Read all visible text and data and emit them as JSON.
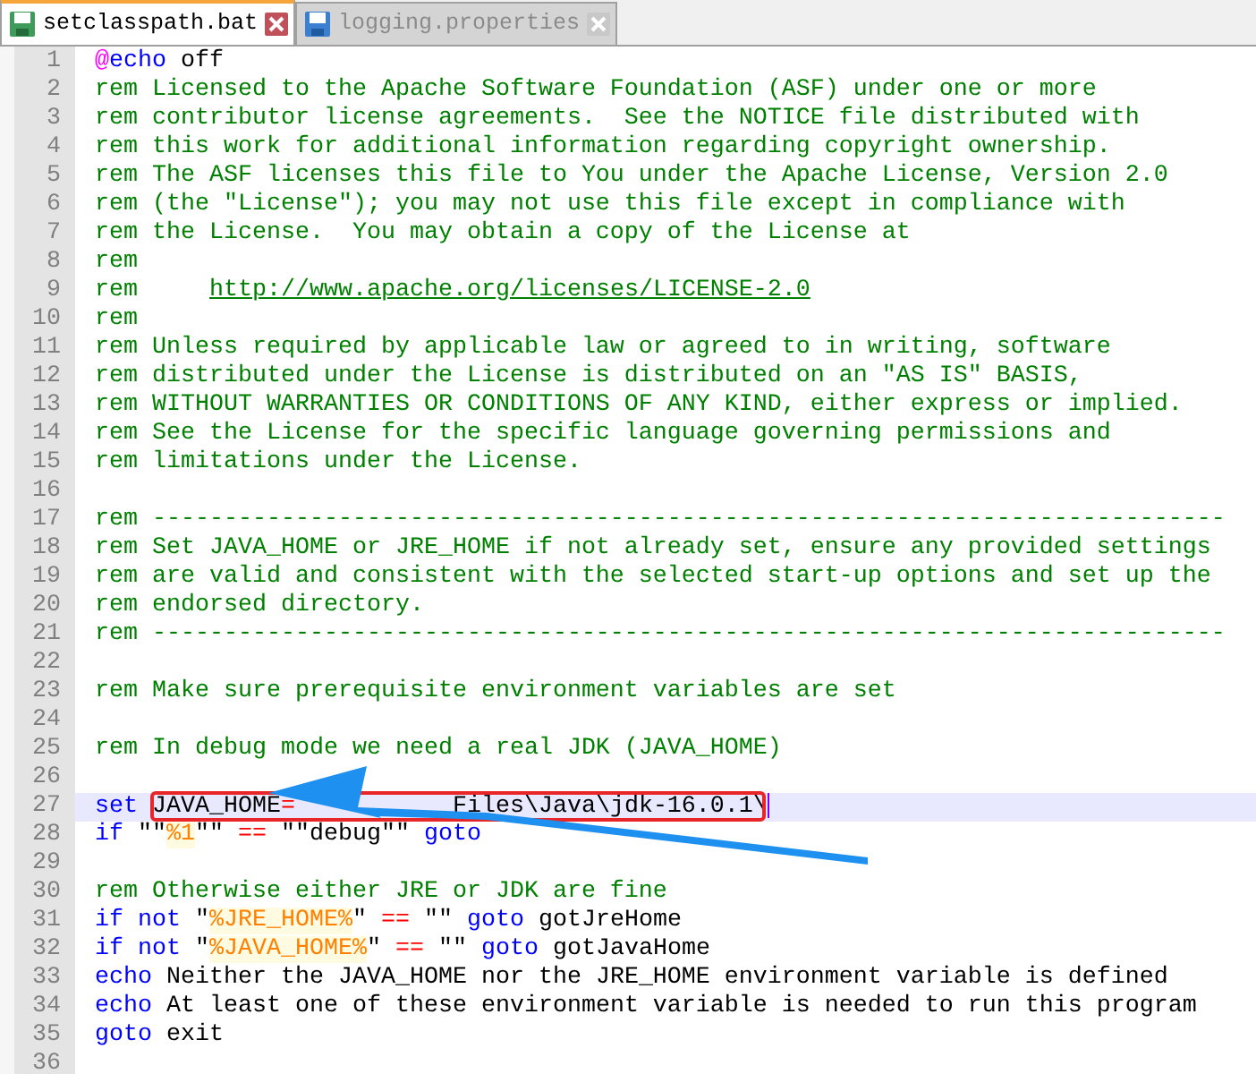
{
  "tabs": [
    {
      "label": "setclasspath.bat",
      "selected": true
    },
    {
      "label": "logging.properties",
      "selected": false
    }
  ],
  "lines": [
    {
      "number": "1",
      "tokens": [
        {
          "kind": "at",
          "text": "@"
        },
        {
          "kind": "keyword",
          "text": "echo"
        },
        {
          "kind": "plain",
          "text": " off"
        }
      ]
    },
    {
      "number": "2",
      "tokens": [
        {
          "kind": "comment",
          "text": "rem Licensed to the Apache Software Foundation (ASF) under one or more"
        }
      ]
    },
    {
      "number": "3",
      "tokens": [
        {
          "kind": "comment",
          "text": "rem contributor license agreements.  See the NOTICE file distributed with"
        }
      ]
    },
    {
      "number": "4",
      "tokens": [
        {
          "kind": "comment",
          "text": "rem this work for additional information regarding copyright ownership."
        }
      ]
    },
    {
      "number": "5",
      "tokens": [
        {
          "kind": "comment",
          "text": "rem The ASF licenses this file to You under the Apache License, Version 2.0"
        }
      ]
    },
    {
      "number": "6",
      "tokens": [
        {
          "kind": "comment",
          "text": "rem (the \"License\"); you may not use this file except in compliance with"
        }
      ]
    },
    {
      "number": "7",
      "tokens": [
        {
          "kind": "comment",
          "text": "rem the License.  You may obtain a copy of the License at"
        }
      ]
    },
    {
      "number": "8",
      "tokens": [
        {
          "kind": "comment",
          "text": "rem"
        }
      ]
    },
    {
      "number": "9",
      "tokens": [
        {
          "kind": "comment",
          "text": "rem     "
        },
        {
          "kind": "link",
          "text": "http://www.apache.org/licenses/LICENSE-2.0"
        }
      ]
    },
    {
      "number": "10",
      "tokens": [
        {
          "kind": "comment",
          "text": "rem"
        }
      ]
    },
    {
      "number": "11",
      "tokens": [
        {
          "kind": "comment",
          "text": "rem Unless required by applicable law or agreed to in writing, software"
        }
      ]
    },
    {
      "number": "12",
      "tokens": [
        {
          "kind": "comment",
          "text": "rem distributed under the License is distributed on an \"AS IS\" BASIS,"
        }
      ]
    },
    {
      "number": "13",
      "tokens": [
        {
          "kind": "comment",
          "text": "rem WITHOUT WARRANTIES OR CONDITIONS OF ANY KIND, either express or implied."
        }
      ]
    },
    {
      "number": "14",
      "tokens": [
        {
          "kind": "comment",
          "text": "rem See the License for the specific language governing permissions and"
        }
      ]
    },
    {
      "number": "15",
      "tokens": [
        {
          "kind": "comment",
          "text": "rem limitations under the License."
        }
      ]
    },
    {
      "number": "16"
    },
    {
      "number": "17",
      "tokens": [
        {
          "kind": "comment",
          "text": "rem ---------------------------------------------------------------------------"
        }
      ]
    },
    {
      "number": "18",
      "tokens": [
        {
          "kind": "comment",
          "text": "rem Set JAVA_HOME or JRE_HOME if not already set, ensure any provided settings"
        }
      ]
    },
    {
      "number": "19",
      "tokens": [
        {
          "kind": "comment",
          "text": "rem are valid and consistent with the selected start-up options and set up the"
        }
      ]
    },
    {
      "number": "20",
      "tokens": [
        {
          "kind": "comment",
          "text": "rem endorsed directory."
        }
      ]
    },
    {
      "number": "21",
      "tokens": [
        {
          "kind": "comment",
          "text": "rem ---------------------------------------------------------------------------"
        }
      ]
    },
    {
      "number": "22"
    },
    {
      "number": "23",
      "tokens": [
        {
          "kind": "comment",
          "text": "rem Make sure prerequisite environment variables are set"
        }
      ]
    },
    {
      "number": "24"
    },
    {
      "number": "25",
      "tokens": [
        {
          "kind": "comment",
          "text": "rem In debug mode we need a real JDK (JAVA_HOME)"
        }
      ]
    },
    {
      "number": "26"
    },
    {
      "number": "27",
      "current": true,
      "highlighted": true,
      "tokens": [
        {
          "kind": "keyword",
          "text": "set"
        },
        {
          "kind": "plain",
          "text": " JAVA_HOME"
        },
        {
          "kind": "operator",
          "text": "="
        },
        {
          "kind": "plain",
          "text": "           Files\\Java\\jdk-16.0.1\\"
        }
      ]
    },
    {
      "number": "28",
      "tokens": [
        {
          "kind": "keyword",
          "text": "if"
        },
        {
          "kind": "plain",
          "text": " \"\""
        },
        {
          "kind": "variable",
          "text": "%1"
        },
        {
          "kind": "plain",
          "text": "\"\" "
        },
        {
          "kind": "operator",
          "text": "=="
        },
        {
          "kind": "plain",
          "text": " \"\"debug\"\" "
        },
        {
          "kind": "keyword",
          "text": "goto"
        }
      ]
    },
    {
      "number": "29"
    },
    {
      "number": "30",
      "tokens": [
        {
          "kind": "comment",
          "text": "rem Otherwise either JRE or JDK are fine"
        }
      ]
    },
    {
      "number": "31",
      "tokens": [
        {
          "kind": "keyword",
          "text": "if not"
        },
        {
          "kind": "plain",
          "text": " \""
        },
        {
          "kind": "variable",
          "text": "%JRE_HOME%"
        },
        {
          "kind": "plain",
          "text": "\" "
        },
        {
          "kind": "operator",
          "text": "=="
        },
        {
          "kind": "plain",
          "text": " \"\" "
        },
        {
          "kind": "keyword",
          "text": "goto"
        },
        {
          "kind": "plain",
          "text": " gotJreHome"
        }
      ]
    },
    {
      "number": "32",
      "tokens": [
        {
          "kind": "keyword",
          "text": "if not"
        },
        {
          "kind": "plain",
          "text": " \""
        },
        {
          "kind": "variable",
          "text": "%JAVA_HOME%"
        },
        {
          "kind": "plain",
          "text": "\" "
        },
        {
          "kind": "operator",
          "text": "=="
        },
        {
          "kind": "plain",
          "text": " \"\" "
        },
        {
          "kind": "keyword",
          "text": "goto"
        },
        {
          "kind": "plain",
          "text": " gotJavaHome"
        }
      ]
    },
    {
      "number": "33",
      "tokens": [
        {
          "kind": "keyword",
          "text": "echo"
        },
        {
          "kind": "plain",
          "text": " Neither the JAVA_HOME nor the JRE_HOME environment variable is defined"
        }
      ]
    },
    {
      "number": "34",
      "tokens": [
        {
          "kind": "keyword",
          "text": "echo"
        },
        {
          "kind": "plain",
          "text": " At least one of these environment variable is needed to run this program"
        }
      ]
    },
    {
      "number": "35",
      "tokens": [
        {
          "kind": "keyword",
          "text": "goto"
        },
        {
          "kind": "plain",
          "text": " exit"
        }
      ]
    },
    {
      "number": "36"
    }
  ]
}
